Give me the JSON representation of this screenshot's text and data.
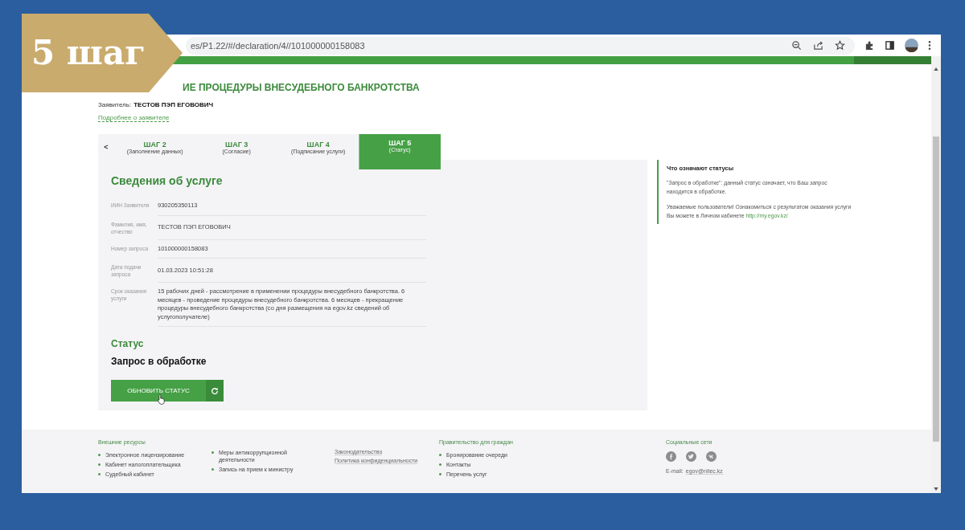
{
  "overlay_badge": {
    "text": "5 шаг"
  },
  "browser": {
    "url": "es/P1.22/#/declaration/4//101000000158083"
  },
  "page": {
    "title": "ИЕ ПРОЦЕДУРЫ ВНЕСУДЕБНОГО БАНКРОТСТВА",
    "applicant_label": "Заявитель:",
    "applicant_name": "ТЕСТОВ ПЭП ЕГОВОВИЧ",
    "applicant_link": "Подробнее о заявителе"
  },
  "steps": {
    "prev": "<",
    "tabs": [
      {
        "label": "ШАГ 2",
        "caption": "(Заполнение данных)",
        "selected": false
      },
      {
        "label": "ШАГ 3",
        "caption": "(Согласие)",
        "selected": false
      },
      {
        "label": "ШАГ 4",
        "caption": "(Подписание услуги)",
        "selected": false
      },
      {
        "label": "ШАГ 5",
        "caption": "(Статус)",
        "selected": true
      }
    ]
  },
  "service": {
    "heading": "Сведения об услуге",
    "fields": [
      {
        "label": "ИИН Заявителя",
        "value": "930205350113"
      },
      {
        "label": "Фамилия, имя, отчество",
        "value": "ТЕСТОВ ПЭП ЕГОВОВИЧ"
      },
      {
        "label": "Номер запроса",
        "value": "101000000158083"
      },
      {
        "label": "Дата подачи запроса",
        "value": "01.03.2023 10:51:28"
      },
      {
        "label": "Срок оказания услуги",
        "value": "15 рабочих дней - рассмотрение в применении процедуры внесудебного банкротства. 6 месяцев - проведение процедуры внесудебного банкротства. 6 месяцев - прекращение процедуры внесудебного банкротства (со дня размещения на egov.kz сведений об услугополучателе)"
      }
    ],
    "status_heading": "Статус",
    "status_value": "Запрос в обработке",
    "refresh_button": "ОБНОВИТЬ СТАТУС"
  },
  "info": {
    "title": "Что означают статусы",
    "text": "\"Запрос в обработке\": данный статус означает, что Ваш запрос находится в обработке.",
    "notice": "Уважаемые пользователи! Ознакомиться с результатом оказания услуги Вы можете в Личном кабинете",
    "link": "http://my.egov.kz/"
  },
  "footer": {
    "columns": [
      {
        "kind": "bullets",
        "heading": "Внешние ресурсы",
        "items": [
          "Электронное лицензирование",
          "Кабинет налогоплательщика",
          "Судебный кабинет"
        ]
      },
      {
        "kind": "bullets",
        "items": [
          "Меры антикоррупционной деятельности",
          "Запись на прием к министру"
        ]
      },
      {
        "kind": "links",
        "items": [
          "Законодательство",
          "Политика конфиденциальности"
        ]
      },
      {
        "kind": "bullets",
        "heading": "Правительство для граждан",
        "items": [
          "Бронирование очереди",
          "Контакты",
          "Перечень услуг"
        ]
      },
      {
        "kind": "social",
        "heading": "Социальные сети",
        "email_label": "E-mail:",
        "email": "egov@nitec.kz"
      }
    ]
  }
}
